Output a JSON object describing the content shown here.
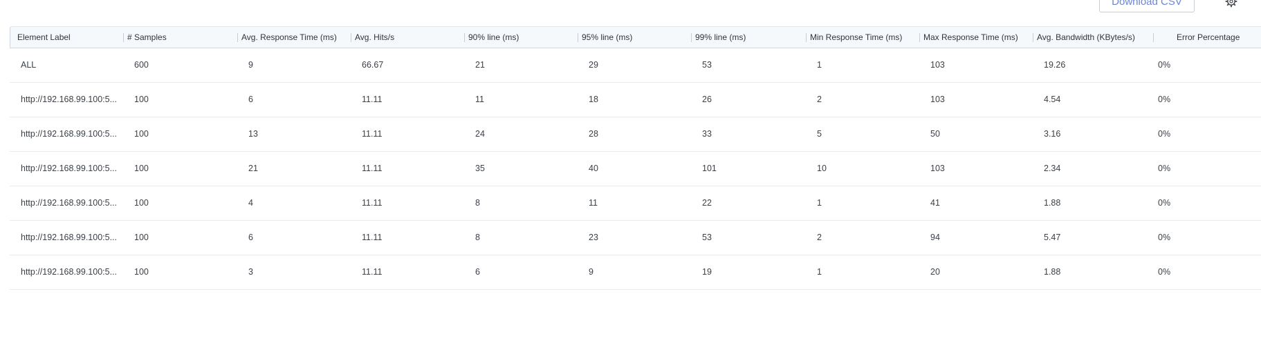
{
  "toolbar": {
    "download_label": "Download CSV",
    "settings_icon": "gear-icon"
  },
  "table": {
    "columns": [
      "Element Label",
      "# Samples",
      "Avg. Response Time (ms)",
      "Avg. Hits/s",
      "90% line (ms)",
      "95% line (ms)",
      "99% line (ms)",
      "Min Response Time (ms)",
      "Max Response Time (ms)",
      "Avg. Bandwidth (KBytes/s)",
      "Error Percentage"
    ],
    "rows": [
      {
        "label": "ALL",
        "samples": "600",
        "avg_rt": "9",
        "hits": "66.67",
        "p90": "21",
        "p95": "29",
        "p99": "53",
        "min": "1",
        "max": "103",
        "bw": "19.26",
        "err": "0%"
      },
      {
        "label": "http://192.168.99.100:5...",
        "samples": "100",
        "avg_rt": "6",
        "hits": "11.11",
        "p90": "11",
        "p95": "18",
        "p99": "26",
        "min": "2",
        "max": "103",
        "bw": "4.54",
        "err": "0%"
      },
      {
        "label": "http://192.168.99.100:5...",
        "samples": "100",
        "avg_rt": "13",
        "hits": "11.11",
        "p90": "24",
        "p95": "28",
        "p99": "33",
        "min": "5",
        "max": "50",
        "bw": "3.16",
        "err": "0%"
      },
      {
        "label": "http://192.168.99.100:5...",
        "samples": "100",
        "avg_rt": "21",
        "hits": "11.11",
        "p90": "35",
        "p95": "40",
        "p99": "101",
        "min": "10",
        "max": "103",
        "bw": "2.34",
        "err": "0%"
      },
      {
        "label": "http://192.168.99.100:5...",
        "samples": "100",
        "avg_rt": "4",
        "hits": "11.11",
        "p90": "8",
        "p95": "11",
        "p99": "22",
        "min": "1",
        "max": "41",
        "bw": "1.88",
        "err": "0%"
      },
      {
        "label": "http://192.168.99.100:5...",
        "samples": "100",
        "avg_rt": "6",
        "hits": "11.11",
        "p90": "8",
        "p95": "23",
        "p99": "53",
        "min": "2",
        "max": "94",
        "bw": "5.47",
        "err": "0%"
      },
      {
        "label": "http://192.168.99.100:5...",
        "samples": "100",
        "avg_rt": "3",
        "hits": "11.11",
        "p90": "6",
        "p95": "9",
        "p99": "19",
        "min": "1",
        "max": "20",
        "bw": "1.88",
        "err": "0%"
      }
    ]
  }
}
